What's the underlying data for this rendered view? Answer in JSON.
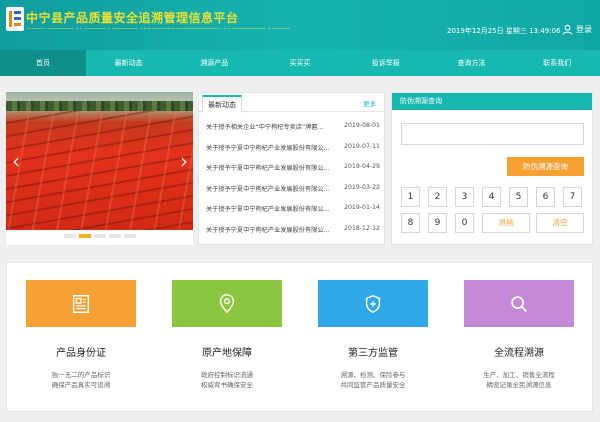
{
  "header": {
    "title": "中宁县产品质量安全追溯管理信息平台",
    "subtitle": "~~~~~ ~~~~~~~ ~~ ~~~~~~~ ~~~~~~~ ~~~ ~~~~~~ ~~~~~~~~~~~~ ~~ ~~~~~~~~~ ~~~~~~",
    "datetime": "2019年12月25日  星期三  13:49:06",
    "login_label": "登录"
  },
  "nav": {
    "items": [
      {
        "label": "首页"
      },
      {
        "label": "最新动态"
      },
      {
        "label": "溯源产品"
      },
      {
        "label": "买买买"
      },
      {
        "label": "投诉举报"
      },
      {
        "label": "查询方法"
      },
      {
        "label": "联系我们"
      }
    ]
  },
  "news": {
    "tab_label": "最新动态",
    "more_label": "更多",
    "items": [
      {
        "title": "关于授予相关企业“中宁枸杞专卖店”牌匾...",
        "date": "2019-08-01"
      },
      {
        "title": "关于授予宁夏中宁枸杞产业发展股份有限公...",
        "date": "2019-07-11"
      },
      {
        "title": "关于授予宁夏中宁枸杞产业发展股份有限公...",
        "date": "2019-04-29"
      },
      {
        "title": "关于授予宁夏中宁枸杞产业发展股份有限公...",
        "date": "2019-03-22"
      },
      {
        "title": "关于授予宁夏中宁枸杞产业发展股份有限公...",
        "date": "2019-01-14"
      },
      {
        "title": "关于授予宁夏中宁枸杞产业发展股份有限公...",
        "date": "2018-12-12"
      }
    ]
  },
  "query": {
    "title": "防伪溯源查询",
    "input_value": "",
    "button_label": "防伪溯源查询",
    "keys": [
      "1",
      "2",
      "3",
      "4",
      "5",
      "6",
      "7",
      "8",
      "9",
      "0"
    ],
    "back_label": "退格",
    "clear_label": "清空"
  },
  "features": [
    {
      "title": "产品身份证",
      "desc1": "独一无二的产品标识",
      "desc2": "确保产品真实可追溯",
      "color": "#f5a134",
      "icon": "document-icon"
    },
    {
      "title": "原产地保障",
      "desc1": "政府控制标识流通",
      "desc2": "权威背书确保安全",
      "color": "#8cc63f",
      "icon": "location-pin-icon"
    },
    {
      "title": "第三方监管",
      "desc1": "溯源、检测、保险参与",
      "desc2": "共同监管产品质量安全",
      "color": "#2fa8e8",
      "icon": "shield-plus-icon"
    },
    {
      "title": "全流程溯源",
      "desc1": "生产、加工、销售全流程",
      "desc2": "精密记录全民溯源信息",
      "color": "#c489d6",
      "icon": "search-icon"
    }
  ],
  "colors": {
    "primary": "#17b8b0",
    "nav_active": "#0e8f8a",
    "accent": "#f5a134"
  }
}
